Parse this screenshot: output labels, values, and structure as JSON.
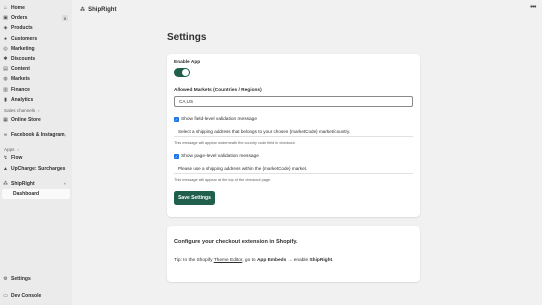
{
  "sidebar": {
    "items": [
      {
        "label": "Home",
        "icon": "home-icon",
        "glyph": "⌂"
      },
      {
        "label": "Orders",
        "icon": "orders-icon",
        "glyph": "▣",
        "badge": "5"
      },
      {
        "label": "Products",
        "icon": "products-icon",
        "glyph": "◈"
      },
      {
        "label": "Customers",
        "icon": "customers-icon",
        "glyph": "●"
      },
      {
        "label": "Marketing",
        "icon": "marketing-icon",
        "glyph": "◎"
      },
      {
        "label": "Discounts",
        "icon": "discounts-icon",
        "glyph": "✱"
      },
      {
        "label": "Content",
        "icon": "content-icon",
        "glyph": "▤"
      },
      {
        "label": "Markets",
        "icon": "markets-icon",
        "glyph": "◍"
      },
      {
        "label": "Finance",
        "icon": "finance-icon",
        "glyph": "▥"
      },
      {
        "label": "Analytics",
        "icon": "analytics-icon",
        "glyph": "▮"
      }
    ],
    "sales_channels_label": "Sales channels",
    "online_store_label": "Online Store",
    "facebook_label": "Facebook & Instagram",
    "apps_label": "Apps",
    "apps": [
      {
        "label": "Flow",
        "icon": "flow-icon",
        "glyph": "↯"
      },
      {
        "label": "UpCharge: Surcharges",
        "icon": "upcharge-icon",
        "glyph": "▲"
      }
    ],
    "shipright_label": "ShipRight",
    "dashboard_label": "Dashboard",
    "settings_label": "Settings",
    "dev_console_label": "Dev Console"
  },
  "topbar": {
    "app_name": "ShipRight",
    "more": "•••"
  },
  "page": {
    "title": "Settings"
  },
  "settings_form": {
    "enable_app_label": "Enable App",
    "enable_app_on": true,
    "allowed_markets_label": "Allowed Markets (Countries / Regions)",
    "allowed_markets_value": "CA,US",
    "field_validation_label": "Show field-level validation message",
    "field_validation_checked": true,
    "field_validation_message": "Select a shipping address that belongs to your chosen {marketCode} market/country.",
    "field_validation_help": "This message will appear underneath the country code field in checkout.",
    "page_validation_label": "Show page-level validation message",
    "page_validation_checked": true,
    "page_validation_message": "Please use a shipping address within the {marketCode} market.",
    "page_validation_help": "This message will appear at the top of the checkout page.",
    "save_label": "Save Settings"
  },
  "extension_card": {
    "title": "Configure your checkout extension in Shopify.",
    "tip_prefix": "Tip: In the Shopify ",
    "tip_link": "Theme Editor",
    "tip_middle": ", go to ",
    "tip_bold_1": "App Embeds",
    "tip_arrow": " → enable ",
    "tip_bold_2": "ShipRight",
    "tip_end": "."
  },
  "colors": {
    "primary_green": "#1f5f4c",
    "checkbox_blue": "#1a73e8",
    "sidebar_bg": "#ebebeb",
    "page_bg": "#f1f1f1"
  }
}
